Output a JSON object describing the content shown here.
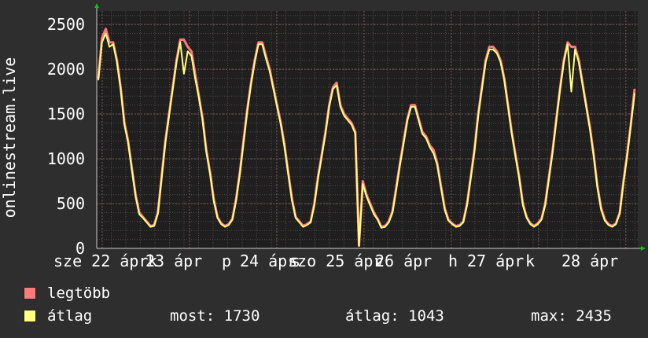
{
  "chart_data": {
    "type": "line",
    "ylabel": "onlinestream.live",
    "ylim": [
      0,
      2650
    ],
    "yticks": [
      0,
      500,
      1000,
      1500,
      2000,
      2500
    ],
    "x_tick_labels": [
      "sze 22 ápr",
      "23 ápr",
      "24 ápr",
      "szo 25 ápr",
      "26 ápr",
      "27 ápr",
      "28 ápr"
    ],
    "x_tick_overprints": [
      "k",
      "p",
      "s",
      "v",
      "h",
      "k"
    ],
    "grid": true,
    "legend_placement": "bottom",
    "series": [
      {
        "name": "legtöbb",
        "color": "#ff7a7a",
        "values": [
          1900,
          2350,
          2450,
          2300,
          2300,
          2100,
          1800,
          1400,
          1200,
          900,
          600,
          400,
          350,
          300,
          250,
          260,
          400,
          800,
          1200,
          1500,
          1800,
          2100,
          2330,
          2330,
          2250,
          2200,
          1950,
          1700,
          1450,
          1100,
          850,
          550,
          350,
          280,
          250,
          270,
          330,
          550,
          850,
          1200,
          1550,
          1850,
          2100,
          2300,
          2300,
          2150,
          2000,
          1800,
          1600,
          1400,
          1150,
          850,
          550,
          350,
          300,
          250,
          270,
          300,
          500,
          800,
          1050,
          1300,
          1600,
          1800,
          1850,
          1600,
          1500,
          1450,
          1400,
          1300,
          830,
          750,
          600,
          500,
          400,
          330,
          240,
          250,
          300,
          420,
          680,
          950,
          1200,
          1450,
          1600,
          1600,
          1450,
          1300,
          1250,
          1150,
          1100,
          950,
          700,
          450,
          320,
          280,
          250,
          260,
          300,
          500,
          800,
          1100,
          1500,
          1800,
          2100,
          2250,
          2250,
          2200,
          2100,
          1900,
          1600,
          1300,
          1050,
          800,
          500,
          350,
          280,
          250,
          280,
          330,
          500,
          800,
          1100,
          1450,
          1800,
          2100,
          2300,
          2250,
          2250,
          2100,
          1850,
          1600,
          1350,
          1050,
          700,
          450,
          320,
          270,
          250,
          280,
          400,
          750,
          1050,
          1400,
          1780
        ],
        "dips": [
          {
            "x_index": 70,
            "value": 30,
            "series": "both"
          },
          {
            "x_index": 127,
            "value": 1750,
            "series": "átlag"
          },
          {
            "x_index": 23,
            "value": 1950,
            "series": "átlag"
          }
        ]
      },
      {
        "name": "átlag",
        "color": "#ffff80",
        "values": [
          1880,
          2300,
          2400,
          2250,
          2280,
          2080,
          1780,
          1380,
          1180,
          880,
          580,
          380,
          340,
          290,
          240,
          250,
          390,
          780,
          1180,
          1480,
          1780,
          2080,
          2300,
          2300,
          2200,
          2150,
          1900,
          1680,
          1430,
          1080,
          830,
          530,
          340,
          270,
          240,
          260,
          320,
          530,
          830,
          1180,
          1530,
          1830,
          2080,
          2280,
          2280,
          2120,
          1980,
          1780,
          1580,
          1380,
          1130,
          830,
          530,
          340,
          290,
          240,
          260,
          290,
          480,
          780,
          1030,
          1280,
          1580,
          1780,
          1820,
          1580,
          1480,
          1430,
          1380,
          1280,
          800,
          720,
          580,
          480,
          380,
          320,
          230,
          240,
          290,
          400,
          660,
          930,
          1180,
          1430,
          1580,
          1580,
          1430,
          1280,
          1230,
          1130,
          1060,
          930,
          680,
          430,
          310,
          270,
          240,
          250,
          290,
          480,
          780,
          1080,
          1480,
          1780,
          2080,
          2220,
          2220,
          2180,
          2080,
          1880,
          1580,
          1280,
          1030,
          780,
          480,
          340,
          270,
          240,
          270,
          320,
          480,
          780,
          1080,
          1430,
          1780,
          2080,
          2280,
          2220,
          2220,
          2080,
          1830,
          1580,
          1330,
          1030,
          680,
          430,
          310,
          260,
          240,
          270,
          390,
          730,
          1030,
          1380,
          1730
        ]
      }
    ]
  },
  "legend": [
    {
      "label": "legtöbb",
      "color": "#ff7a7a"
    },
    {
      "label": "átlag",
      "color": "#ffff80"
    }
  ],
  "stats": {
    "now": "most: 1730",
    "avg": "átlag: 1043",
    "max": "max: 2435"
  },
  "colors": {
    "background": "#2e2e2e",
    "plot_background": "#1f1f1f",
    "grid": "#5a4a4a",
    "text": "#ffffff",
    "arrow": "#00cc00"
  }
}
